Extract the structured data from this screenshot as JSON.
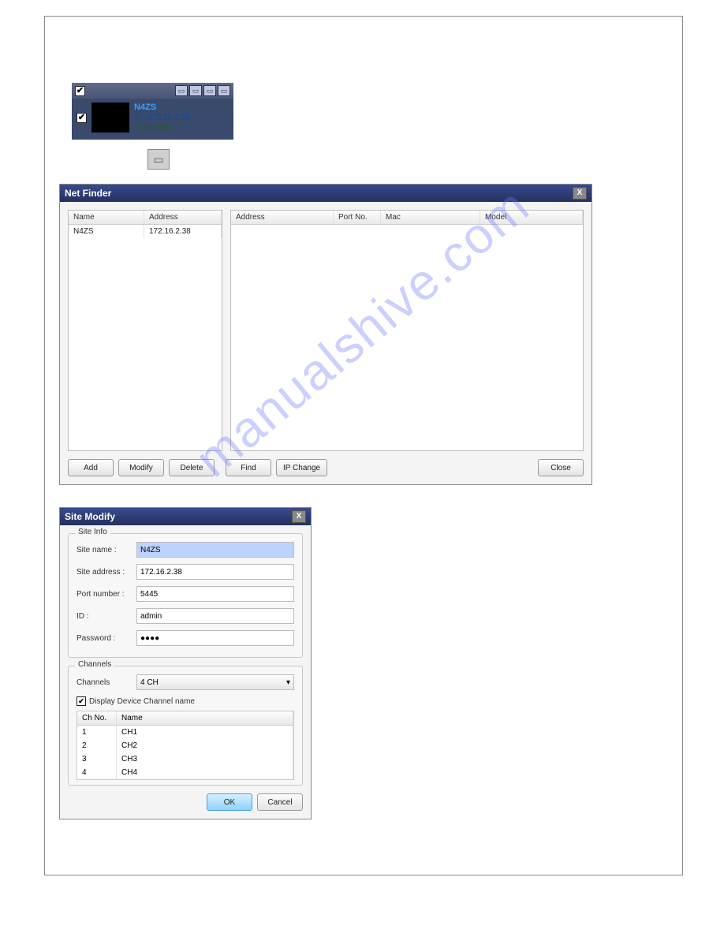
{
  "device_panel": {
    "name": "N4ZS",
    "ip_label": "IP : 172.16.2.38",
    "status": "Connected"
  },
  "netfinder": {
    "title": "Net Finder",
    "left_cols": {
      "name": "Name",
      "address": "Address"
    },
    "left_rows": [
      {
        "name": "N4ZS",
        "address": "172.16.2.38"
      }
    ],
    "right_cols": {
      "address": "Address",
      "port": "Port No.",
      "mac": "Mac",
      "model": "Model"
    },
    "buttons": {
      "add": "Add",
      "modify": "Modify",
      "delete": "Delete",
      "find": "Find",
      "ipchange": "IP Change",
      "close": "Close"
    }
  },
  "sitemodify": {
    "title": "Site Modify",
    "siteinfo_legend": "Site Info",
    "labels": {
      "site_name": "Site name :",
      "site_address": "Site address :",
      "port_number": "Port number :",
      "id": "ID :",
      "password": "Password :"
    },
    "values": {
      "site_name": "N4ZS",
      "site_address": "172.16.2.38",
      "port_number": "5445",
      "id": "admin",
      "password": "●●●●"
    },
    "channels_legend": "Channels",
    "channels_label": "Channels",
    "channels_value": "4 CH",
    "display_channel_label": "Display Device Channel name",
    "ch_cols": {
      "no": "Ch No.",
      "name": "Name"
    },
    "ch_rows": [
      {
        "no": "1",
        "name": "CH1"
      },
      {
        "no": "2",
        "name": "CH2"
      },
      {
        "no": "3",
        "name": "CH3"
      },
      {
        "no": "4",
        "name": "CH4"
      }
    ],
    "buttons": {
      "ok": "OK",
      "cancel": "Cancel"
    }
  },
  "watermark": "manualshive.com"
}
